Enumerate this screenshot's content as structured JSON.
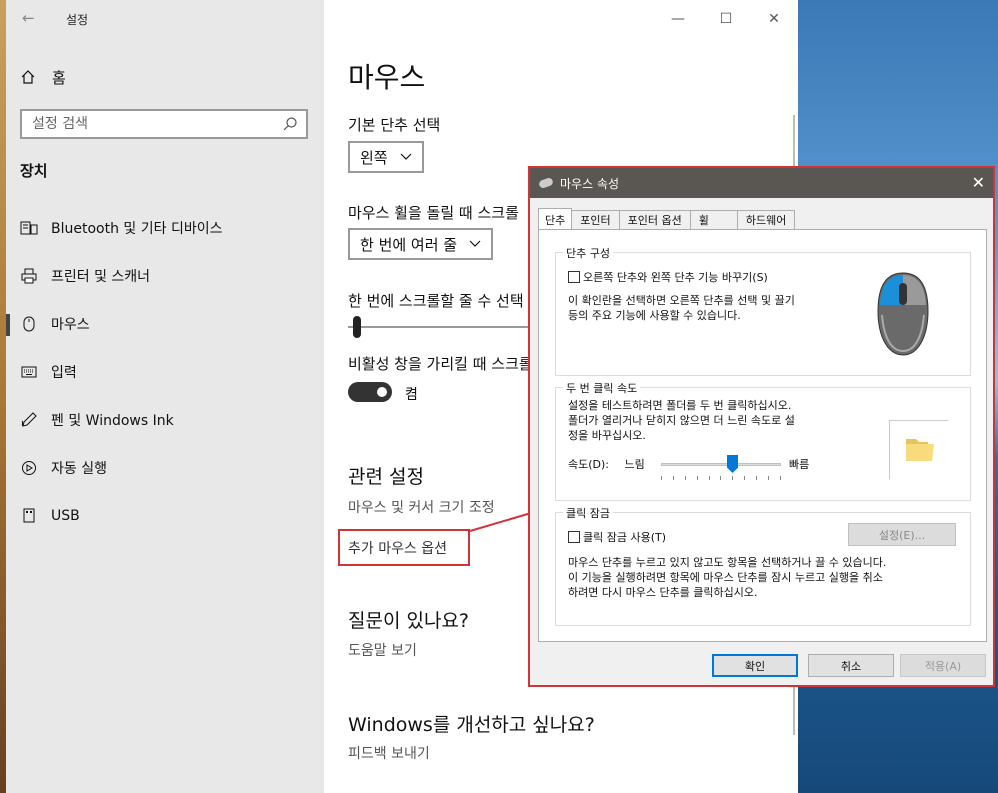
{
  "window": {
    "title": "설정",
    "controls": {
      "minimize": "—",
      "maximize": "☐",
      "close": "✕"
    }
  },
  "sidebar": {
    "home_label": "홈",
    "search_placeholder": "설정 검색",
    "section_title": "장치",
    "items": [
      {
        "label": "Bluetooth 및 기타 디바이스",
        "icon": "bluetooth-devices-icon"
      },
      {
        "label": "프린터 및 스캐너",
        "icon": "printer-icon"
      },
      {
        "label": "마우스",
        "icon": "mouse-icon",
        "active": true
      },
      {
        "label": "입력",
        "icon": "keyboard-icon"
      },
      {
        "label": "펜 및 Windows Ink",
        "icon": "pen-icon"
      },
      {
        "label": "자동 실행",
        "icon": "autoplay-icon"
      },
      {
        "label": "USB",
        "icon": "usb-icon"
      }
    ]
  },
  "main": {
    "title": "마우스",
    "primary_button_label": "기본 단추 선택",
    "primary_button_value": "왼쪽",
    "scroll_label": "마우스 휠을 돌릴 때 스크롤",
    "scroll_value": "한 번에 여러 줄",
    "lines_label": "한 번에 스크롤할 줄 수 선택",
    "lines_value": 1,
    "inactive_scroll_label": "비활성 창을 가리킬 때 스크롤",
    "inactive_scroll_state": "켬",
    "related_title": "관련 설정",
    "related_links": [
      "마우스 및 커서 크기 조정",
      "추가 마우스 옵션"
    ],
    "question_title": "질문이 있나요?",
    "help_link": "도움말 보기",
    "improve_title": "Windows를 개선하고 싶나요?",
    "feedback_link": "피드백 보내기"
  },
  "dialog": {
    "title": "마우스 속성",
    "tabs": [
      "단추",
      "포인터",
      "포인터 옵션",
      "휠",
      "하드웨어"
    ],
    "button_config": {
      "group_title": "단추 구성",
      "checkbox_label": "오른쪽 단추와 왼쪽 단추 기능 바꾸기(S)",
      "checked": false,
      "description": [
        "이 확인란을 선택하면 오른쪽 단추를 선택 및 끌기",
        "등의 주요 기능에 사용할 수 있습니다."
      ]
    },
    "double_click": {
      "group_title": "두 번 클릭 속도",
      "description": [
        "설정을 테스트하려면 폴더를 두 번 클릭하십시오.",
        "폴더가 열리거나 닫히지 않으면 더 느린 속도로 설",
        "정을 바꾸십시오."
      ],
      "speed_label": "속도(D):",
      "slow_label": "느림",
      "fast_label": "빠름",
      "speed_value": 0.6
    },
    "click_lock": {
      "group_title": "클릭 잠금",
      "checkbox_label": "클릭 잠금 사용(T)",
      "checked": false,
      "settings_button": "설정(E)...",
      "description": [
        "마우스 단추를 누르고 있지 않고도 항목을 선택하거나 끌 수 있습니다.",
        "이 기능을 실행하려면 항목에 마우스 단추를 잠시 누르고 실행을 취소",
        "하려면 다시 마우스 단추를 클릭하십시오."
      ]
    },
    "buttons": {
      "ok": "확인",
      "cancel": "취소",
      "apply": "적용(A)"
    }
  },
  "colors": {
    "accent": "#0078d7",
    "highlight": "#d13438",
    "sidebar_bg": "#e8e8e8",
    "dialog_title_bg": "#5a5752"
  }
}
